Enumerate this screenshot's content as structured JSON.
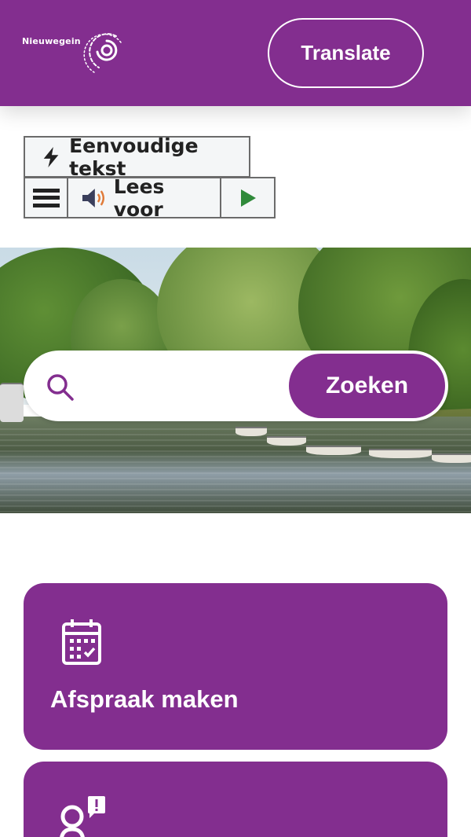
{
  "header": {
    "logo_text": "Nieuwegein",
    "translate_label": "Translate"
  },
  "read_tools": {
    "simple_text_label": "Eenvoudige tekst",
    "read_aloud_label": "Lees voor"
  },
  "search": {
    "placeholder": "",
    "button_label": "Zoeken"
  },
  "cards": [
    {
      "title": "Afspraak maken",
      "icon": "calendar-icon"
    },
    {
      "title": "",
      "icon": "person-alert-icon"
    }
  ],
  "colors": {
    "brand_purple": "#832e8f",
    "white": "#ffffff",
    "play_green": "#2f8a3a"
  }
}
